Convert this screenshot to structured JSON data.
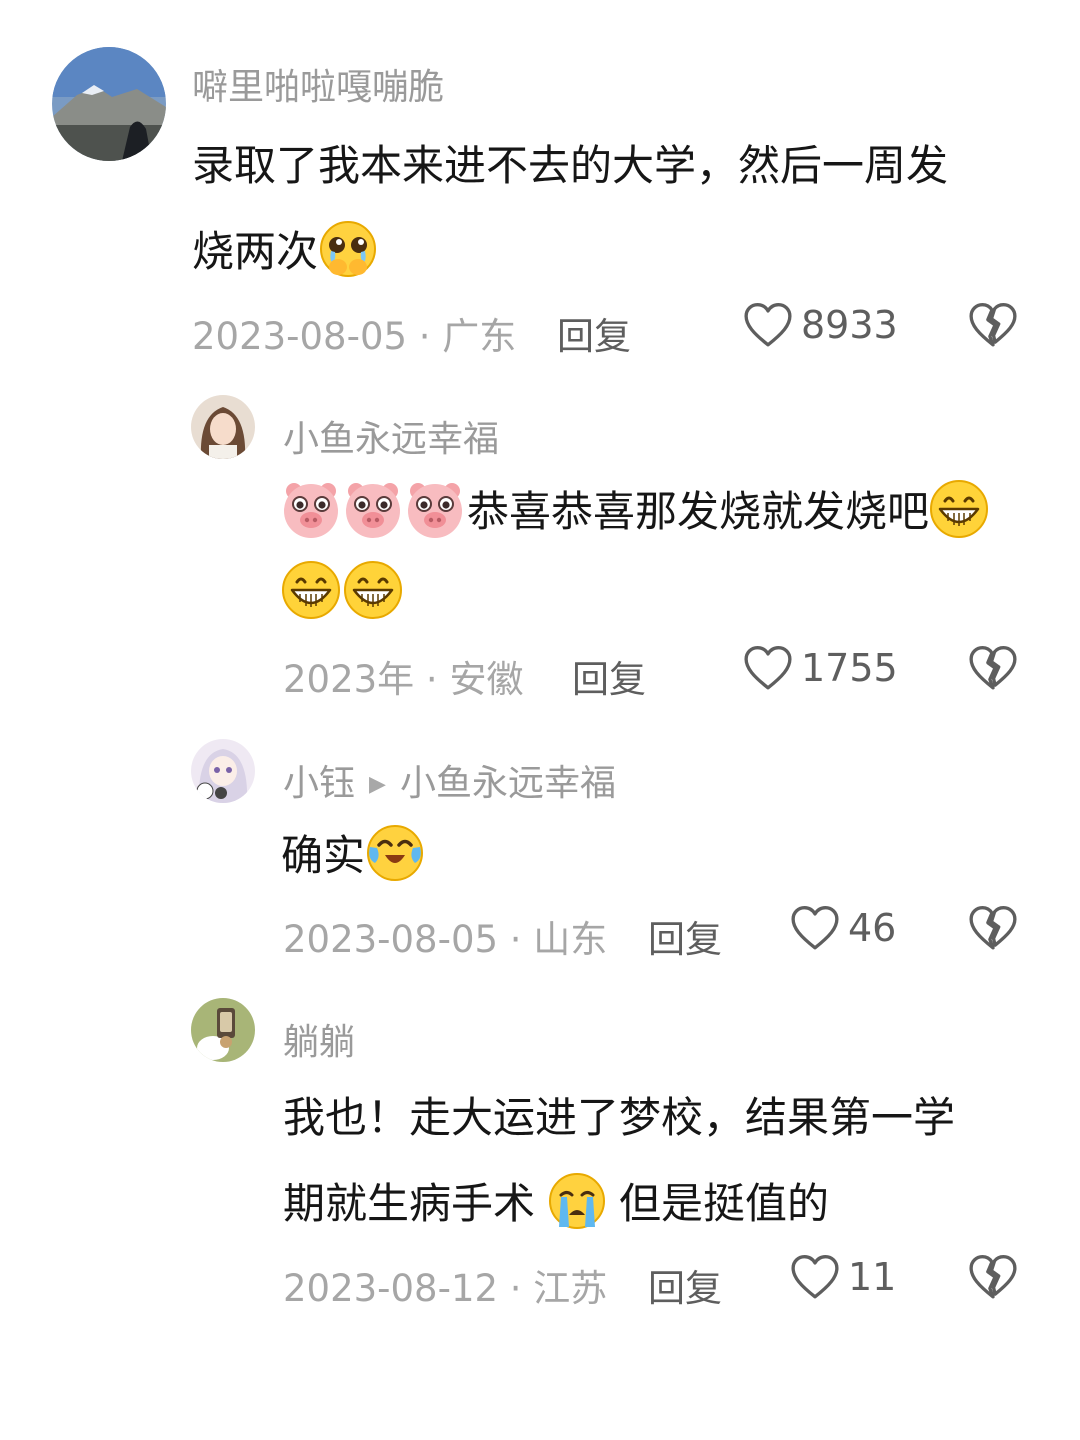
{
  "comments": [
    {
      "username": "噼里啪啦嘎嘣脆",
      "line1": "录取了我本来进不去的大学，然后一周发",
      "line2": "烧两次",
      "meta": "2023-08-05 · 广东",
      "reply": "回复",
      "likes": "8933"
    },
    {
      "username": "小鱼永远幸福",
      "line1": "恭喜恭喜那发烧就发烧吧",
      "meta": "2023年 · 安徽",
      "reply": "回复",
      "likes": "1755"
    },
    {
      "username": "小钰",
      "reply_to": "小鱼永远幸福",
      "line1": "确实",
      "meta": "2023-08-05 · 山东",
      "reply": "回复",
      "likes": "46"
    },
    {
      "username": "躺躺",
      "line1": "我也！走大运进了梦校，结果第一学",
      "line2a": "期就生病手术",
      "line2b": "但是挺值的",
      "meta": "2023-08-12 · 江苏",
      "reply": "回复",
      "likes": "11"
    }
  ],
  "icons": {
    "like": "heart-outline-icon",
    "dislike": "broken-heart-icon",
    "reply_arrow": "triangle-right-icon"
  }
}
